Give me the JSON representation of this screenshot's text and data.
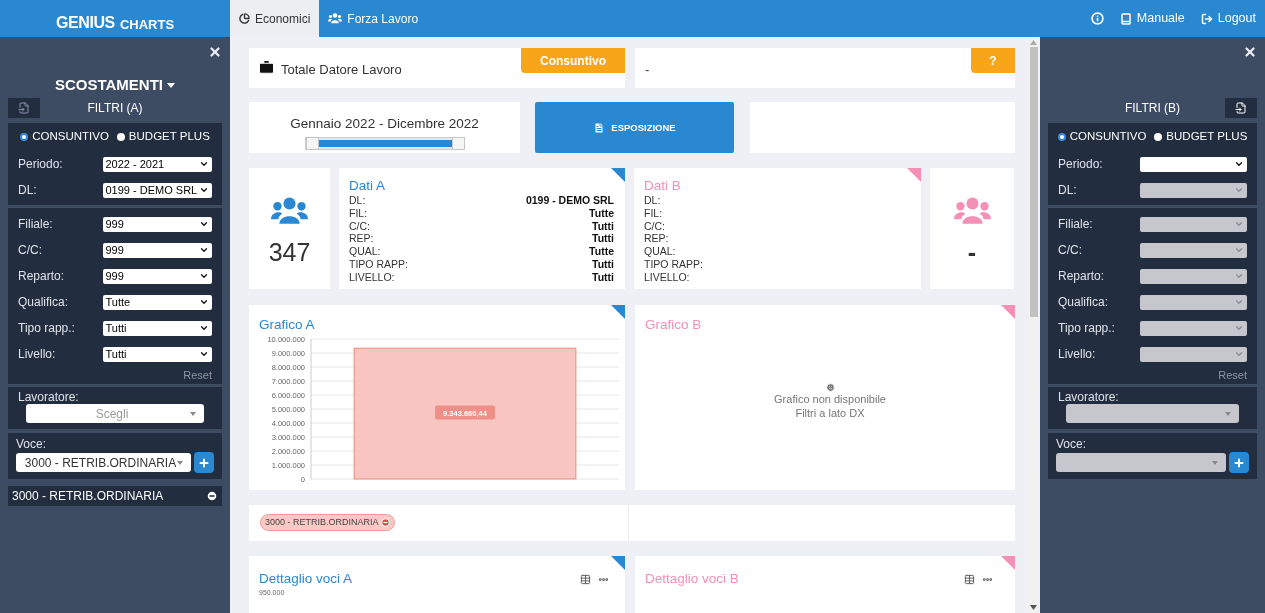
{
  "header": {
    "logo": {
      "main": "GENIUS",
      "sub": "CHARTS"
    },
    "tabs": [
      {
        "label": "Economici",
        "selected": true,
        "kind": "pie"
      },
      {
        "label": "Forza Lavoro",
        "selected": false,
        "kind": "users"
      }
    ],
    "actions": [
      {
        "kind": "info"
      },
      {
        "kind": "manual",
        "label": "Manuale"
      },
      {
        "kind": "logout",
        "label": "Logout"
      }
    ]
  },
  "filters_a": {
    "title": "SCOSTAMENTI",
    "panel_title": "FILTRI (A)",
    "modes": [
      {
        "label": "CONSUNTIVO",
        "selected": true
      },
      {
        "label": "BUDGET PLUS",
        "selected": false
      }
    ],
    "main_fields": [
      {
        "label": "Periodo:",
        "value": "2022 - 2021",
        "disabled": false
      },
      {
        "label": "DL:",
        "value": "0199 - DEMO SRL",
        "disabled": false
      }
    ],
    "detail_fields": [
      {
        "label": "Filiale:",
        "value": "999",
        "disabled": false
      },
      {
        "label": "C/C:",
        "value": "999",
        "disabled": false
      },
      {
        "label": "Reparto:",
        "value": "999",
        "disabled": false
      },
      {
        "label": "Qualifica:",
        "value": "Tutte",
        "disabled": false
      },
      {
        "label": "Tipo rapp.:",
        "value": "Tutti",
        "disabled": false
      },
      {
        "label": "Livello:",
        "value": "Tutti",
        "disabled": false
      }
    ],
    "reset": "Reset",
    "worker": {
      "label": "Lavoratore:",
      "placeholder": "Scegli",
      "disabled": false
    },
    "voce": {
      "label": "Voce:",
      "value": "3000 - RETRIB.ORDINARIA",
      "disabled": false
    },
    "selected_items": [
      "3000 - RETRIB.ORDINARIA"
    ]
  },
  "summary": {
    "employer": {
      "title": "Totale Datore Lavoro",
      "badge": "Consuntivo"
    },
    "compare": {
      "title": "-",
      "badge": "?"
    }
  },
  "period": {
    "label": "Gennaio 2022 - Dicembre 2022",
    "level": 1
  },
  "export_button": "ESPOSIZIONE",
  "headcount_a": "347",
  "data_a": {
    "title": "Dati A",
    "rows": [
      {
        "label": "DL:",
        "value": "0199 - DEMO SRL"
      },
      {
        "label": "FIL:",
        "value": "Tutte"
      },
      {
        "label": "C/C:",
        "value": "Tutti"
      },
      {
        "label": "REP:",
        "value": "Tutti"
      },
      {
        "label": "QUAL:",
        "value": "Tutte"
      },
      {
        "label": "TIPO RAPP:",
        "value": "Tutti"
      },
      {
        "label": "LIVELLO:",
        "value": "Tutti"
      }
    ]
  },
  "data_b": {
    "title": "Dati B",
    "rows": [
      {
        "label": "DL:"
      },
      {
        "label": "FIL:"
      },
      {
        "label": "C/C:"
      },
      {
        "label": "REP:"
      },
      {
        "label": "QUAL:"
      },
      {
        "label": "TIPO RAPP:"
      },
      {
        "label": "LIVELLO:"
      }
    ]
  },
  "headcount_b": "-",
  "chart_a": {
    "title": "Grafico A",
    "chart_data": {
      "type": "bar",
      "values": [
        9343660.44
      ],
      "ylim": [
        0,
        10000000
      ],
      "yticks": [
        {
          "value": 0,
          "label": "0"
        },
        {
          "value": 1000000,
          "label": "1.000.000"
        },
        {
          "value": 2000000,
          "label": "2.000.000"
        },
        {
          "value": 3000000,
          "label": "3.000.000"
        },
        {
          "value": 4000000,
          "label": "4.000.000"
        },
        {
          "value": 5000000,
          "label": "5.000.000"
        },
        {
          "value": 6000000,
          "label": "6.000.000"
        },
        {
          "value": 7000000,
          "label": "7.000.000"
        },
        {
          "value": 8000000,
          "label": "8.000.000"
        },
        {
          "value": 9000000,
          "label": "9.000.000"
        },
        {
          "value": 10000000,
          "label": "10.000.000"
        }
      ],
      "value_labels": [
        "9.343.660,44"
      ],
      "grid": true
    }
  },
  "chart_b": {
    "title": "Grafico B",
    "message": [
      "Grafico non disponibile",
      "Filtri a lato DX"
    ]
  },
  "tags": [
    {
      "label": "3000 - RETRIB.ORDINARIA"
    }
  ],
  "detail_a": {
    "title": "Dettaglio voci A",
    "first_tick": "950.000"
  },
  "detail_b": {
    "title": "Dettaglio voci B"
  },
  "filters_b": {
    "panel_title": "FILTRI (B)",
    "modes": [
      {
        "label": "CONSUNTIVO",
        "selected": true
      },
      {
        "label": "BUDGET PLUS",
        "selected": false
      }
    ],
    "main_fields": [
      {
        "label": "Periodo:",
        "disabled": false
      },
      {
        "label": "DL:",
        "disabled": true
      }
    ],
    "detail_fields": [
      {
        "label": "Filiale:",
        "disabled": true
      },
      {
        "label": "C/C:",
        "disabled": true
      },
      {
        "label": "Reparto:",
        "disabled": true
      },
      {
        "label": "Qualifica:",
        "disabled": true
      },
      {
        "label": "Tipo rapp.:",
        "disabled": true
      },
      {
        "label": "Livello:",
        "disabled": true
      }
    ],
    "reset": "Reset",
    "worker": {
      "label": "Lavoratore:",
      "disabled": true
    },
    "voce": {
      "label": "Voce:",
      "disabled": true
    }
  }
}
